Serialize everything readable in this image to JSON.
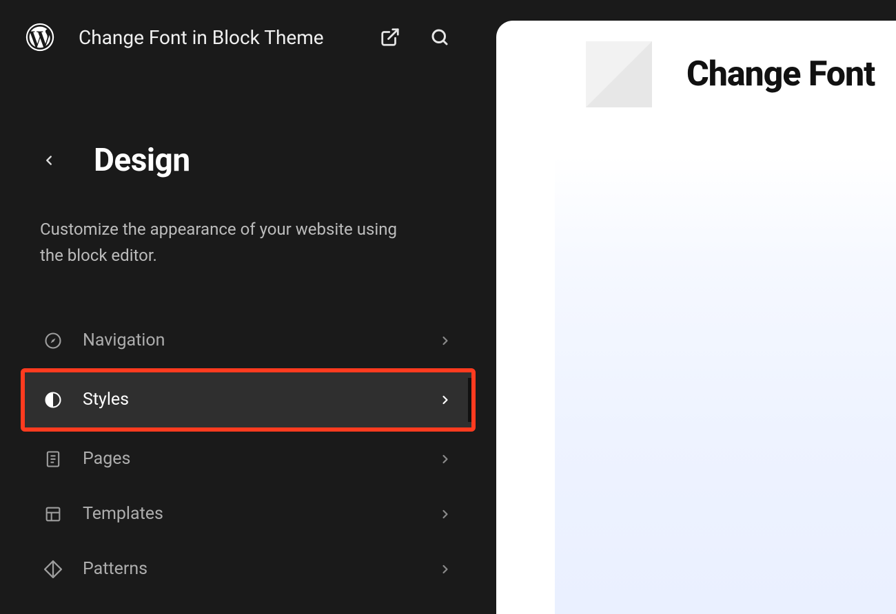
{
  "header": {
    "site_title": "Change Font in Block Theme"
  },
  "section": {
    "title": "Design",
    "description": "Customize the appearance of your website using the block editor."
  },
  "menu": {
    "items": [
      {
        "label": "Navigation",
        "icon": "compass-icon",
        "active": false,
        "highlighted": false
      },
      {
        "label": "Styles",
        "icon": "contrast-icon",
        "active": true,
        "highlighted": true
      },
      {
        "label": "Pages",
        "icon": "page-icon",
        "active": false,
        "highlighted": false
      },
      {
        "label": "Templates",
        "icon": "layout-icon",
        "active": false,
        "highlighted": false
      },
      {
        "label": "Patterns",
        "icon": "diamond-icon",
        "active": false,
        "highlighted": false
      }
    ]
  },
  "preview": {
    "title": "Change Font"
  },
  "colors": {
    "highlight": "#ff3b1f",
    "sidebar_bg": "#1a1a1a",
    "active_bg": "#2f2f2f"
  }
}
